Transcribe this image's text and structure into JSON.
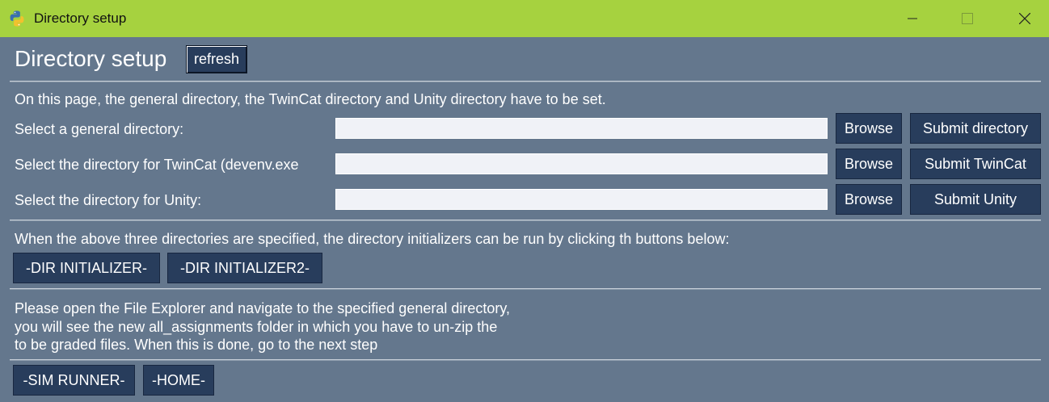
{
  "window": {
    "title": "Directory setup"
  },
  "header": {
    "title": "Directory setup",
    "refresh_label": "refresh"
  },
  "intro": "On this page, the general directory, the TwinCat directory and Unity directory have to be set.",
  "rows": [
    {
      "label": "Select a general directory:",
      "value": "",
      "browse_label": "Browse",
      "submit_label": "Submit directory"
    },
    {
      "label": "Select the directory for TwinCat (devenv.exe",
      "value": "",
      "browse_label": "Browse",
      "submit_label": "Submit TwinCat"
    },
    {
      "label": "Select the directory for Unity:",
      "value": "",
      "browse_label": "Browse",
      "submit_label": "Submit Unity"
    }
  ],
  "initializers": {
    "text": "When the above three directories are specified, the directory initializers can be run by clicking th buttons below:",
    "button1": "-DIR INITIALIZER-",
    "button2": "-DIR INITIALIZER2-"
  },
  "instructions": {
    "line1": "Please open the File Explorer and navigate to the specified general directory,",
    "line2": "you will see the new all_assignments folder in which you have to un-zip the",
    "line3": "to be graded files. When this is done, go to the next step"
  },
  "footer": {
    "sim_runner": "-SIM RUNNER-",
    "home": "-HOME-"
  },
  "colors": {
    "titlebar": "#a6d23f",
    "background": "#64778d",
    "button": "#283d5c",
    "field": "#f0f2f7"
  }
}
